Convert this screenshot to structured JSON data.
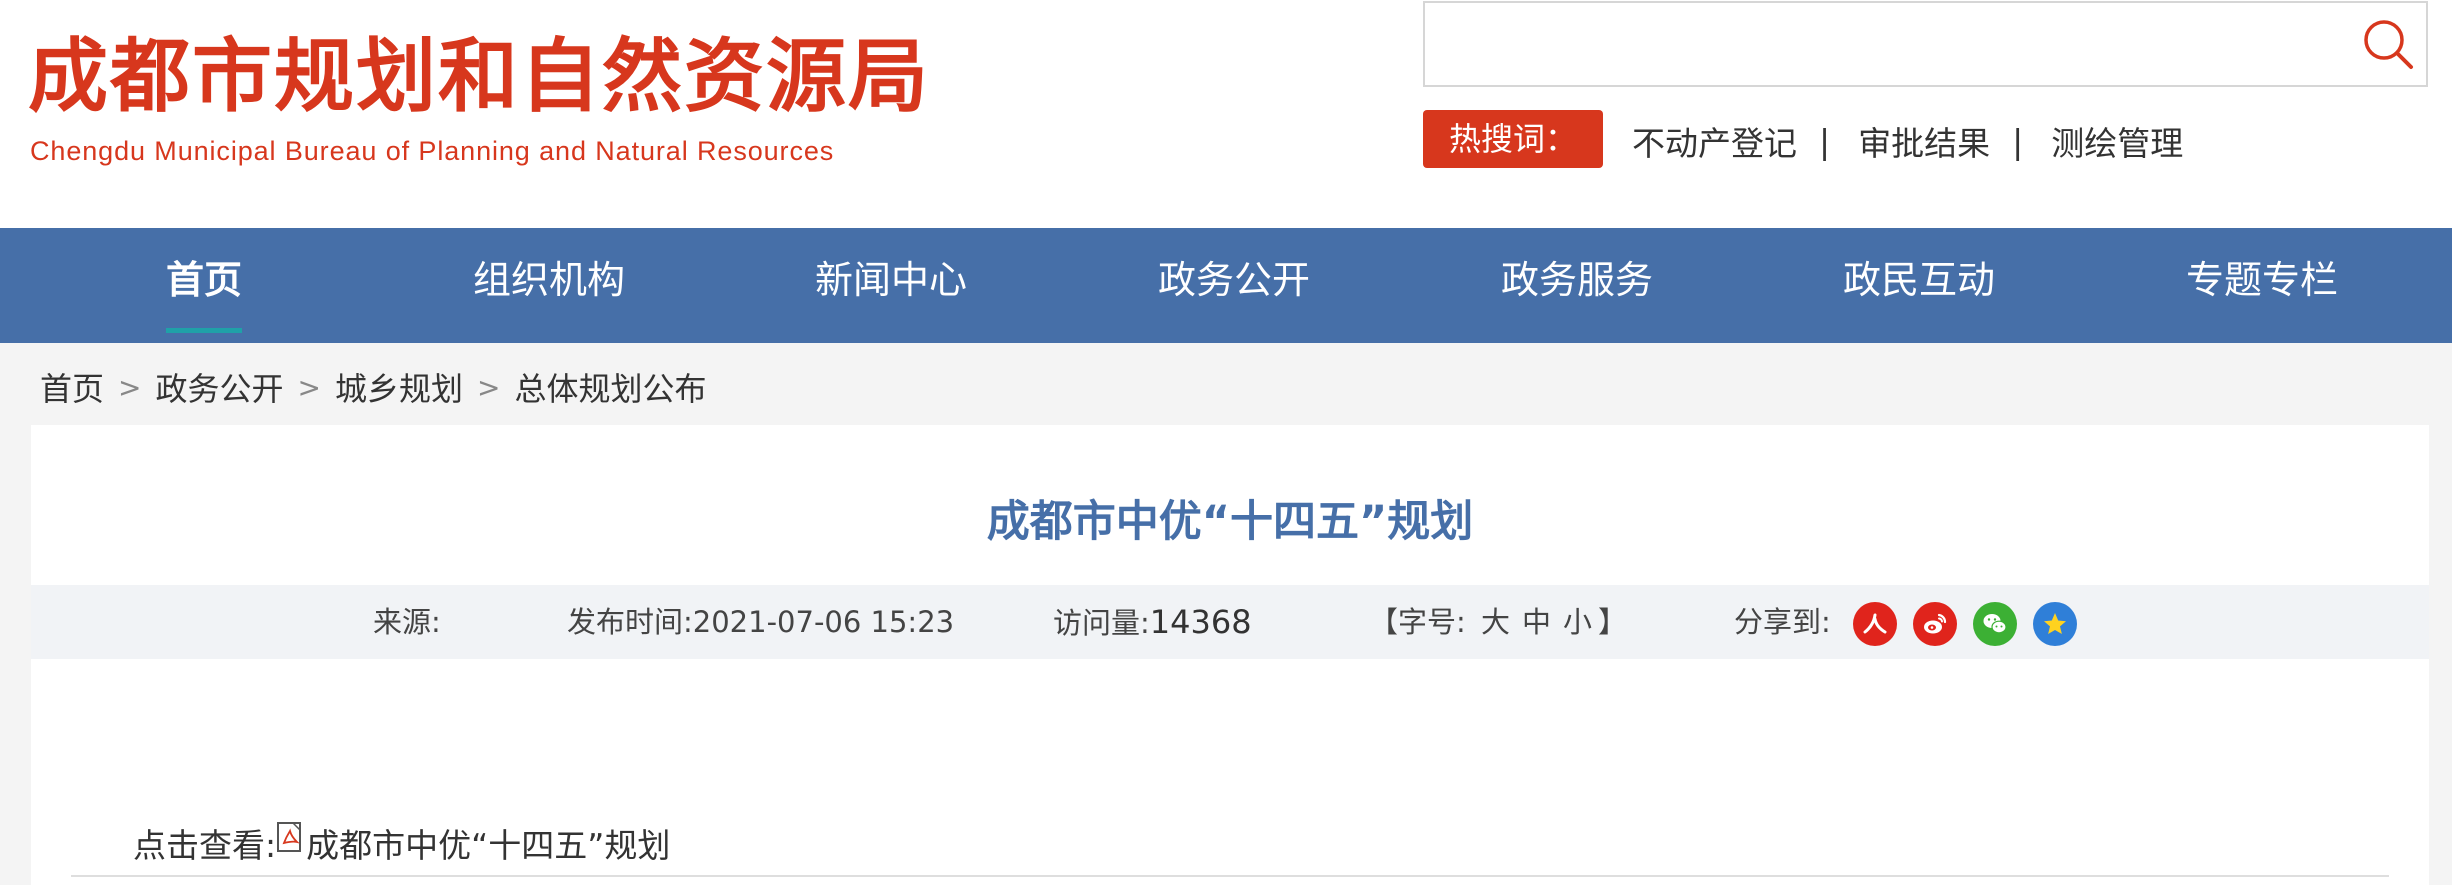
{
  "header": {
    "logo_cn": "成都市规划和自然资源局",
    "logo_en": "Chengdu Municipal Bureau of Planning and Natural Resources",
    "search_placeholder": "",
    "hot_label": "热搜词：",
    "hot_links": [
      "不动产登记",
      "审批结果",
      "测绘管理"
    ],
    "hot_sep": "|"
  },
  "nav": {
    "items": [
      "首页",
      "组织机构",
      "新闻中心",
      "政务公开",
      "政务服务",
      "政民互动",
      "专题专栏"
    ]
  },
  "breadcrumb": {
    "items": [
      "首页",
      "政务公开",
      "城乡规划",
      "总体规划公布"
    ],
    "sep": ">"
  },
  "article": {
    "title": "成都市中优“十四五”规划",
    "source_label": "来源:",
    "publish_label": "发布时间:",
    "publish_time": "2021-07-06 15:23",
    "views_label": "访问量:",
    "views": "14368",
    "font_open": "【字号:",
    "font_large": "大",
    "font_medium": "中",
    "font_small": "小",
    "font_close": "】",
    "share_label": "分享到:",
    "view_label": "点击查看:",
    "file_name": "成都市中优“十四五”规划"
  },
  "colors": {
    "brand_red": "#d7371d",
    "nav_blue": "#466fa8",
    "title_blue": "#466fa8",
    "nav_underline": "#1fa1a8",
    "share_renren": "#e0241c",
    "share_weibo": "#e0241c",
    "share_wechat": "#3cb034",
    "share_favorite": "#2f7fd8"
  },
  "icons": {
    "search": "search-icon",
    "share": [
      "renren-icon",
      "weibo-icon",
      "wechat-icon",
      "favorite-star-icon"
    ],
    "file": "pdf-file-icon"
  }
}
